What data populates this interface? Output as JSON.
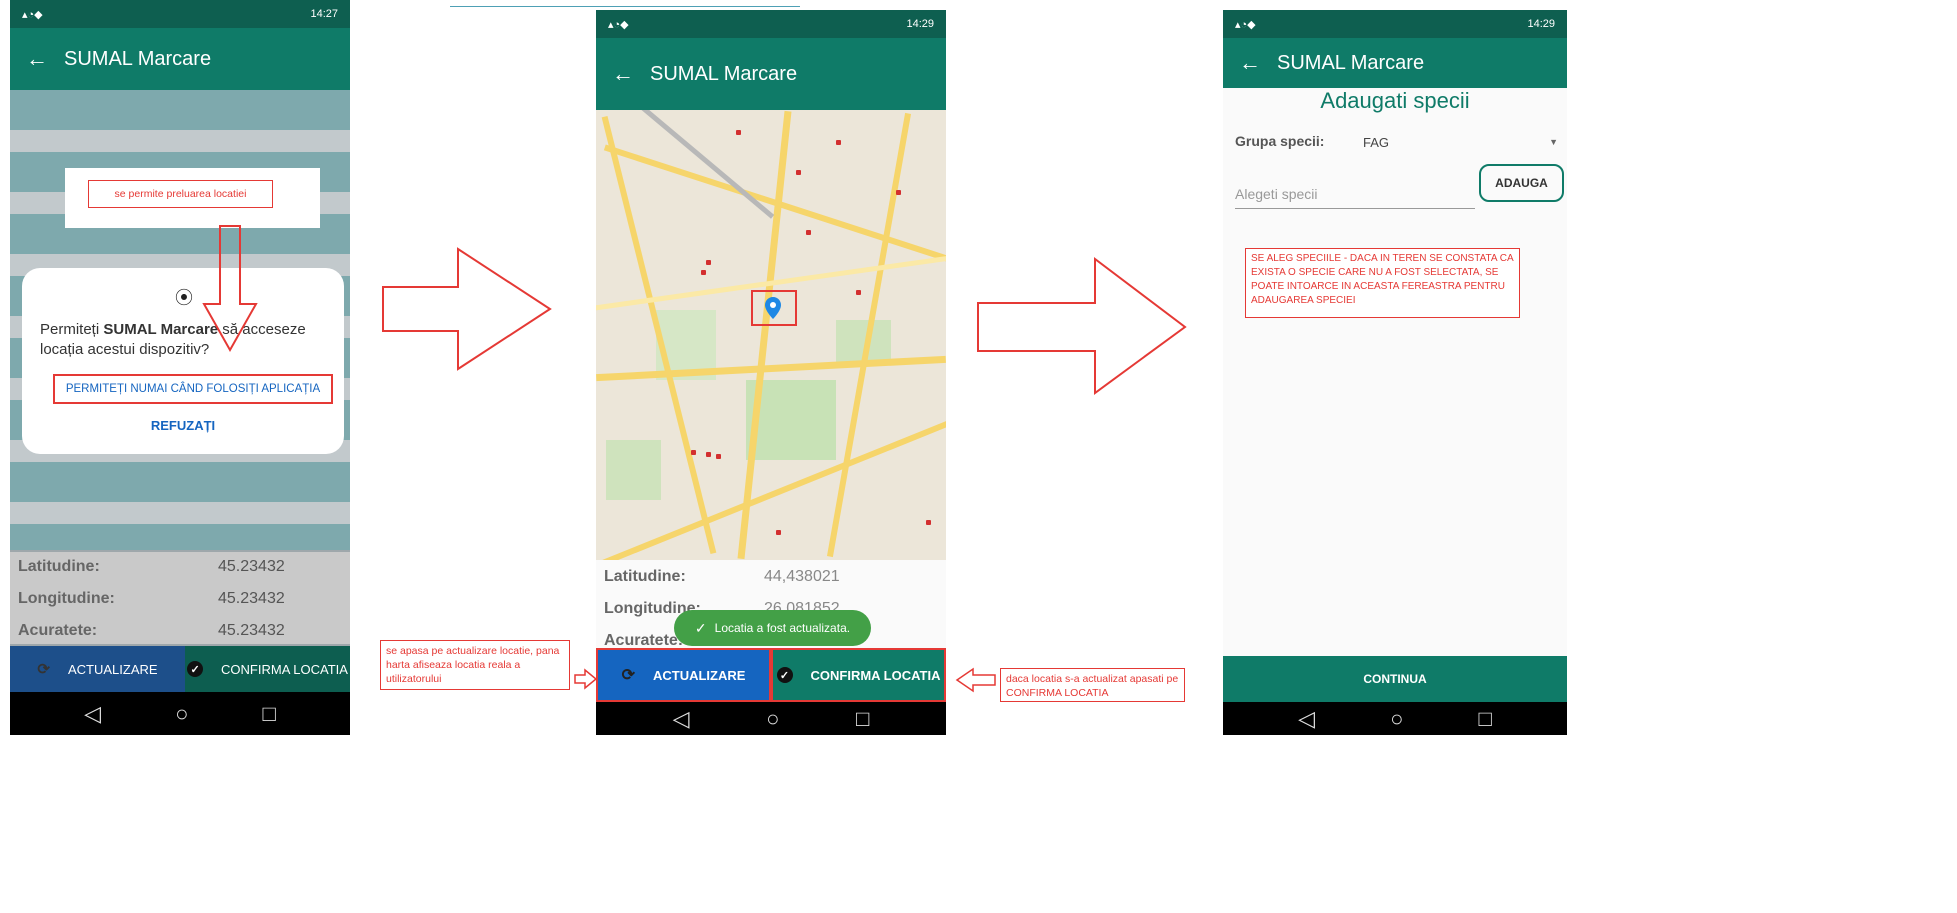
{
  "screen1": {
    "status_time": "14:27",
    "app_title": "SUMAL Marcare",
    "note_allow": "se permite preluarea locatiei",
    "dialog_text_before": "Permiteți ",
    "dialog_text_bold": "SUMAL Marcare",
    "dialog_text_after": " să acceseze locația acestui dispozitiv?",
    "allow_button": "PERMITEȚI NUMAI CÂND FOLOSIȚI APLICAȚIA",
    "deny_button": "REFUZAȚI",
    "rows": [
      {
        "label": "Latitudine:",
        "value": "45.23432"
      },
      {
        "label": "Longitudine:",
        "value": "45.23432"
      },
      {
        "label": "Acuratete:",
        "value": "45.23432"
      }
    ],
    "update_button": "ACTUALIZARE",
    "confirm_button": "CONFIRMA LOCATIA"
  },
  "screen2": {
    "status_time": "14:29",
    "app_title": "SUMAL Marcare",
    "rows": [
      {
        "label": "Latitudine:",
        "value": "44,438021"
      },
      {
        "label": "Longitudine:",
        "value": "26.081852"
      },
      {
        "label": "Acuratete:",
        "value": ""
      }
    ],
    "toast": "Locatia a fost actualizata.",
    "update_button": "ACTUALIZARE",
    "confirm_button": "CONFIRMA LOCATIA",
    "note_left": "se apasa pe actualizare locatie, pana harta afiseaza locatia reala a utilizatorului",
    "note_right": "daca locatia s-a actualizat apasati pe CONFIRMA LOCATIA"
  },
  "screen3": {
    "status_time": "14:29",
    "app_title": "SUMAL Marcare",
    "heading": "Adaugati specii",
    "group_label": "Grupa specii:",
    "group_value": "FAG",
    "species_placeholder": "Alegeti specii",
    "add_button": "ADAUGA",
    "note": "SE ALEG SPECIILE - DACA IN TEREN SE CONSTATA CA EXISTA O SPECIE CARE NU A FOST SELECTATA, SE POATE INTOARCE IN ACEASTA FEREASTRA PENTRU ADAUGAREA SPECIEI",
    "continue_button": "CONTINUA"
  },
  "colors": {
    "appbar": "#0f7b68",
    "update": "#1565c0",
    "annotation": "#e53935"
  }
}
